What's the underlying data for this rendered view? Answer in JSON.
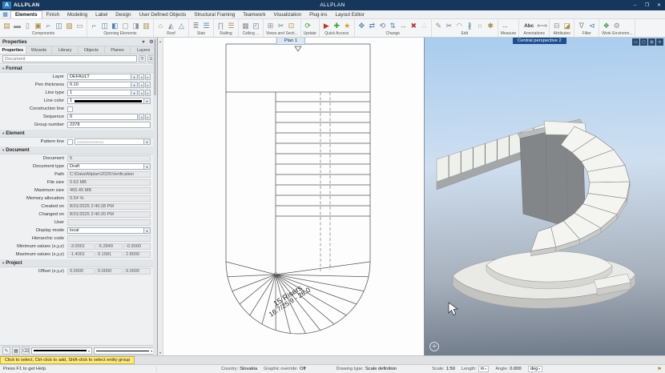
{
  "title_bar": {
    "logo_text": "A",
    "brand": "ALLPLAN",
    "title": "ALLPLAN",
    "controls": {
      "minimize": "–",
      "maximize": "❐",
      "close": "✕"
    }
  },
  "menu": {
    "active": "Elements",
    "items": [
      "Elements",
      "Finish",
      "Modeling",
      "Label",
      "Design",
      "User Defined Objects",
      "Structural Framing",
      "Teamwork",
      "Visualization",
      "Plug-ins",
      "Layout Editor"
    ]
  },
  "ribbon": {
    "groups": [
      {
        "label": "Components",
        "icons": [
          {
            "n": "wall-icon",
            "g": "▤",
            "c": "#b08d4a"
          },
          {
            "n": "downstand-beam-icon",
            "g": "▬",
            "c": "#8a8f94"
          },
          {
            "n": "column-icon",
            "g": "▯",
            "c": "#8a8f94"
          },
          {
            "n": "chimney-icon",
            "g": "▣",
            "c": "#b08d4a"
          },
          {
            "n": "door-icon",
            "g": "⌐",
            "c": "#4f81b0"
          },
          {
            "n": "window-icon",
            "g": "◫",
            "c": "#4f81b0"
          },
          {
            "n": "smart-wall-icon",
            "g": "▨",
            "c": "#b08d4a"
          },
          {
            "n": "slab-icon",
            "g": "▭",
            "c": "#8a8f94"
          }
        ]
      },
      {
        "label": "Opening Elements",
        "icons": [
          {
            "n": "door-opening-icon",
            "g": "⌐",
            "c": "#4f81b0"
          },
          {
            "n": "window-opening-icon",
            "g": "◫",
            "c": "#4f81b0"
          },
          {
            "n": "french-window-icon",
            "g": "◧",
            "c": "#4f81b0"
          },
          {
            "n": "wall-opening-icon",
            "g": "▢",
            "c": "#8a8f94"
          },
          {
            "n": "niche-icon",
            "g": "◨",
            "c": "#8a8f94"
          },
          {
            "n": "recess-icon",
            "g": "▥",
            "c": "#b08d4a"
          }
        ]
      },
      {
        "label": "Roof",
        "icons": [
          {
            "n": "roofscape-icon",
            "g": "⌂",
            "c": "#b08d4a"
          },
          {
            "n": "roof-covering-icon",
            "g": "◭",
            "c": "#8a8f94"
          },
          {
            "n": "skylight-icon",
            "g": "△",
            "c": "#4f81b0"
          }
        ]
      },
      {
        "label": "Stair",
        "icons": [
          {
            "n": "stair-icon",
            "g": "≣",
            "c": "#8a8f94"
          },
          {
            "n": "stair-modeler-icon",
            "g": "☰",
            "c": "#4f81b0"
          }
        ]
      },
      {
        "label": "Railing",
        "icons": [
          {
            "n": "railing-icon",
            "g": "∏",
            "c": "#8a8f94"
          },
          {
            "n": "fence-icon",
            "g": "☰",
            "c": "#b08d4a"
          }
        ]
      },
      {
        "label": "Ceiling ...",
        "icons": [
          {
            "n": "ceiling-icon",
            "g": "▦",
            "c": "#8a8f94"
          },
          {
            "n": "ceiling-opening-icon",
            "g": "◰",
            "c": "#4f81b0"
          }
        ]
      },
      {
        "label": "Views and Secti...",
        "icons": [
          {
            "n": "view-icon",
            "g": "⊞",
            "c": "#8a8f94"
          },
          {
            "n": "section-icon",
            "g": "✂",
            "c": "#4f81b0"
          },
          {
            "n": "detail-icon",
            "g": "⊡",
            "c": "#b08d4a"
          }
        ]
      },
      {
        "label": "Update",
        "icons": [
          {
            "n": "update-3d-icon",
            "g": "⟳",
            "c": "#3f9e3f"
          }
        ]
      },
      {
        "label": "Quick Access",
        "icons": [
          {
            "n": "play-icon",
            "g": "▶",
            "c": "#c0392b"
          },
          {
            "n": "add-icon",
            "g": "✚",
            "c": "#3f9e3f"
          },
          {
            "n": "favorites-icon",
            "g": "★",
            "c": "#c9a227"
          }
        ]
      },
      {
        "label": "Change",
        "icons": [
          {
            "n": "move-icon",
            "g": "✥",
            "c": "#4f81b0"
          },
          {
            "n": "copy-icon",
            "g": "⇄",
            "c": "#4f81b0"
          },
          {
            "n": "rotate-icon",
            "g": "⟲",
            "c": "#4f81b0"
          },
          {
            "n": "mirror-icon",
            "g": "⇅",
            "c": "#4f81b0"
          },
          {
            "n": "stretch-icon",
            "g": "↔",
            "c": "#8a8f94"
          },
          {
            "n": "delete-icon",
            "g": "✖",
            "c": "#b03a3a"
          },
          {
            "n": "edit-points-icon",
            "g": "∴",
            "c": "#8a8f94"
          }
        ]
      },
      {
        "label": "Edit",
        "icons": [
          {
            "n": "edit-pen-icon",
            "g": "✎",
            "c": "#8a8f94"
          },
          {
            "n": "trim-icon",
            "g": "✂",
            "c": "#4f81b0"
          },
          {
            "n": "fillet-icon",
            "g": "◠",
            "c": "#8a8f94"
          },
          {
            "n": "divide-icon",
            "g": "∦",
            "c": "#4f81b0"
          },
          {
            "n": "intersect-icon",
            "g": "∩",
            "c": "#8a8f94"
          },
          {
            "n": "explode-icon",
            "g": "✱",
            "c": "#b08d4a"
          }
        ]
      },
      {
        "label": "Measure",
        "icons": [
          {
            "n": "measure-icon",
            "g": "↔",
            "c": "#8a8f94"
          }
        ]
      },
      {
        "label": "Annotations",
        "icons": [
          {
            "n": "text-icon",
            "g": "Abc",
            "c": "#333333",
            "wide": true
          },
          {
            "n": "dimension-line-icon",
            "g": "⟷",
            "c": "#8a8f94"
          }
        ]
      },
      {
        "label": "Attributes",
        "icons": [
          {
            "n": "attributes-icon",
            "g": "⊟",
            "c": "#8a8f94"
          },
          {
            "n": "assign-attribute-icon",
            "g": "◪",
            "c": "#b08d4a"
          }
        ]
      },
      {
        "label": "Filter",
        "icons": [
          {
            "n": "filter-icon",
            "g": "∇",
            "c": "#8a8f94"
          },
          {
            "n": "match-filter-icon",
            "g": "⊲",
            "c": "#4f81b0"
          }
        ]
      },
      {
        "label": "Work Environm...",
        "icons": [
          {
            "n": "workgroup-icon",
            "g": "❖",
            "c": "#3f9e3f"
          },
          {
            "n": "settings-icon",
            "g": "⚙",
            "c": "#8a8f94"
          }
        ]
      }
    ]
  },
  "panel": {
    "header": "Properties",
    "tabs": [
      "Properties",
      "Wizards",
      "Library",
      "Objects",
      "Planes",
      "Layers"
    ],
    "active_tab": "Properties",
    "filter_placeholder": "Document",
    "sections": [
      {
        "title": "Format",
        "rows": [
          {
            "label": "Layer",
            "type": "nav-dropdown",
            "value": "DEFAULT"
          },
          {
            "label": "Pen thickness",
            "type": "nav-dropdown",
            "value": "0.10"
          },
          {
            "label": "Line type",
            "type": "nav-dropdown",
            "value": "1"
          },
          {
            "label": "Line color",
            "type": "color-dropdown",
            "value": "1"
          },
          {
            "label": "Construction line",
            "type": "checkbox",
            "value": ""
          },
          {
            "label": "Sequence",
            "type": "spin",
            "value": "0"
          },
          {
            "label": "Group number",
            "type": "text",
            "value": "2378"
          }
        ]
      },
      {
        "title": "Element",
        "rows": [
          {
            "label": "Pattern line",
            "type": "pattern",
            "value": "○○○○○○○○○○○○○○"
          }
        ]
      },
      {
        "title": "Document",
        "rows": [
          {
            "label": "Document",
            "type": "readonly",
            "value": "5"
          },
          {
            "label": "Document type",
            "type": "dropdown",
            "value": "Draft"
          },
          {
            "label": "Path",
            "type": "readonly",
            "value": "C:\\Data\\Allplan\\2025\\Verification"
          },
          {
            "label": "File size",
            "type": "readonly",
            "value": "0.63 MB"
          },
          {
            "label": "Maximum size",
            "type": "readonly",
            "value": "465.45 MB"
          },
          {
            "label": "Memory allocation",
            "type": "readonly",
            "value": "0.54 %"
          },
          {
            "label": "Created on",
            "type": "readonly",
            "value": "8/31/2025 2:40:28 PM"
          },
          {
            "label": "Changed on",
            "type": "readonly",
            "value": "8/31/2025 2:40:20 PM"
          },
          {
            "label": "User",
            "type": "readonly",
            "value": ""
          },
          {
            "label": "Display mode",
            "type": "dropdown",
            "value": "local"
          },
          {
            "label": "Hierarchic code",
            "type": "readonly",
            "value": ""
          },
          {
            "label": "Minimum values (x,y,z)",
            "type": "triple",
            "values": [
              "-3.0001",
              "-5.2849",
              "-0.3000"
            ]
          },
          {
            "label": "Maximum values (x,y,z)",
            "type": "triple",
            "values": [
              "-1.4001",
              "0.1581",
              "2.8000"
            ]
          }
        ]
      },
      {
        "title": "Project",
        "rows": [
          {
            "label": "Offset (x,y,z)",
            "type": "triple",
            "values": [
              "0.0000",
              "0.0000",
              "0.0000"
            ]
          }
        ]
      }
    ],
    "footer_icons": [
      {
        "n": "match-properties-icon",
        "g": "✎"
      },
      {
        "n": "format-brush-icon",
        "g": "▦"
      },
      {
        "n": "reset-format-icon",
        "g": "⌫"
      }
    ]
  },
  "plan_view": {
    "tab": "Plan 1",
    "annotation_line1": "15 Risers",
    "annotation_line2": "16.7/25.9 - 28.0"
  },
  "perspective_view": {
    "tab": "Central perspective 2"
  },
  "prompt_bar": {
    "text": "Click to select, Ctrl-click to add, Shift-click to select entity group"
  },
  "status_bar": {
    "help": "Press F1 to get Help.",
    "items": [
      {
        "label": "Country:",
        "value": "Slovakia"
      },
      {
        "label": "Graphic override:",
        "value": "Off"
      },
      {
        "label": "Drawing type:",
        "value": "Scale definition"
      },
      {
        "label": "Scale:",
        "value": "1:50"
      },
      {
        "label": "Length:",
        "value": "m",
        "dropdown": true
      },
      {
        "label": "Angle:",
        "value": "0.000"
      },
      {
        "label": "",
        "value": "deg",
        "dropdown": true
      }
    ]
  },
  "icons": {
    "app_menu": "▦",
    "gear": "⚙",
    "collapse": "▾",
    "search_funnel": "∇",
    "list": "☰",
    "scroll_up": "▴",
    "scroll_down": "▾",
    "dropdown": "▾",
    "spin_left": "◂",
    "spin_right": "▸",
    "pane_min": "▭",
    "pane_max": "▢",
    "pane_grid": "⊞",
    "pane_close": "✕",
    "compass": "✛",
    "flag": "⚑"
  },
  "colors": {
    "brand_accent": "#2d7fc1",
    "titlebar": "#17365c",
    "view_tab_active": "#1d4e8d",
    "prompt_bg": "#ffe97d"
  }
}
